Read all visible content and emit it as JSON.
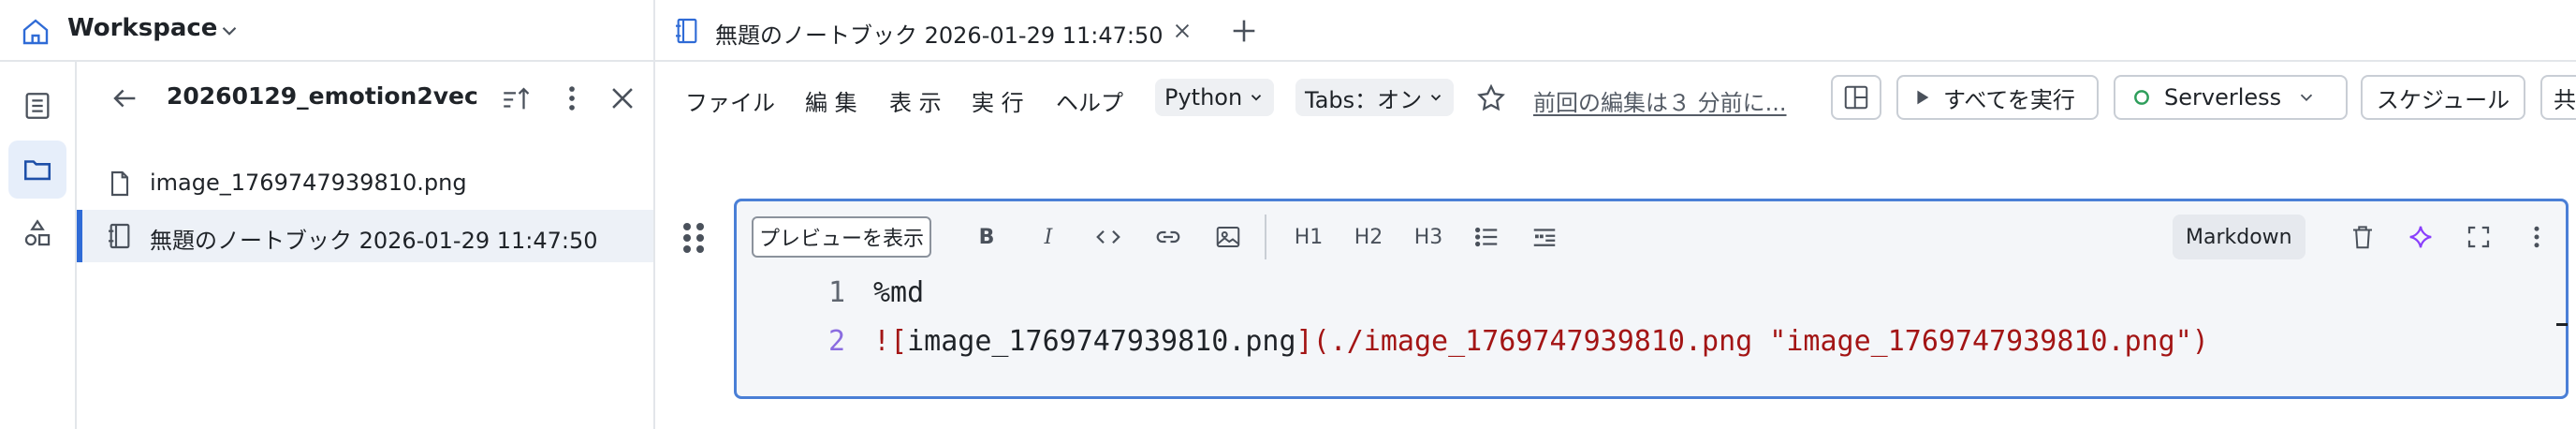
{
  "workspace": {
    "title": "Workspace"
  },
  "browser": {
    "folder": "20260129_emotion2vec",
    "files": [
      {
        "name": "image_1769747939810.png",
        "type": "file"
      },
      {
        "name": "無題のノートブック 2026-01-29 11:47:50",
        "type": "notebook",
        "selected": true
      }
    ]
  },
  "tab": {
    "label": "無題のノートブック 2026-01-29 11:47:50"
  },
  "menu": [
    "ファイル",
    "編 集",
    "表 示",
    "実 行",
    "ヘルプ"
  ],
  "toolbar": {
    "language": "Python",
    "tabs": "Tabs：オン",
    "last_edit": "前回の編集は３ 分前に...",
    "run_all": "すべてを実行",
    "compute": "Serverless",
    "schedule": "スケジュール",
    "share_partial": "共"
  },
  "cell": {
    "preview": "プレビューを表示",
    "tools": [
      "B",
      "I",
      "H1",
      "H2",
      "H3"
    ],
    "type_badge": "Markdown",
    "lines": [
      {
        "number": "1",
        "text": "%md"
      },
      {
        "number": "2",
        "prefix": "!",
        "alt_open": "[",
        "alt": "image_1769747939810.png",
        "alt_close": "]",
        "link": "(./image_1769747939810.png \"image_1769747939810.png\")"
      }
    ]
  },
  "colors": {
    "accent": "#2f6bd6",
    "cell_border": "#4a7fd6",
    "ai": "#8a3ffc",
    "compute_dot": "#2e9e5b"
  }
}
